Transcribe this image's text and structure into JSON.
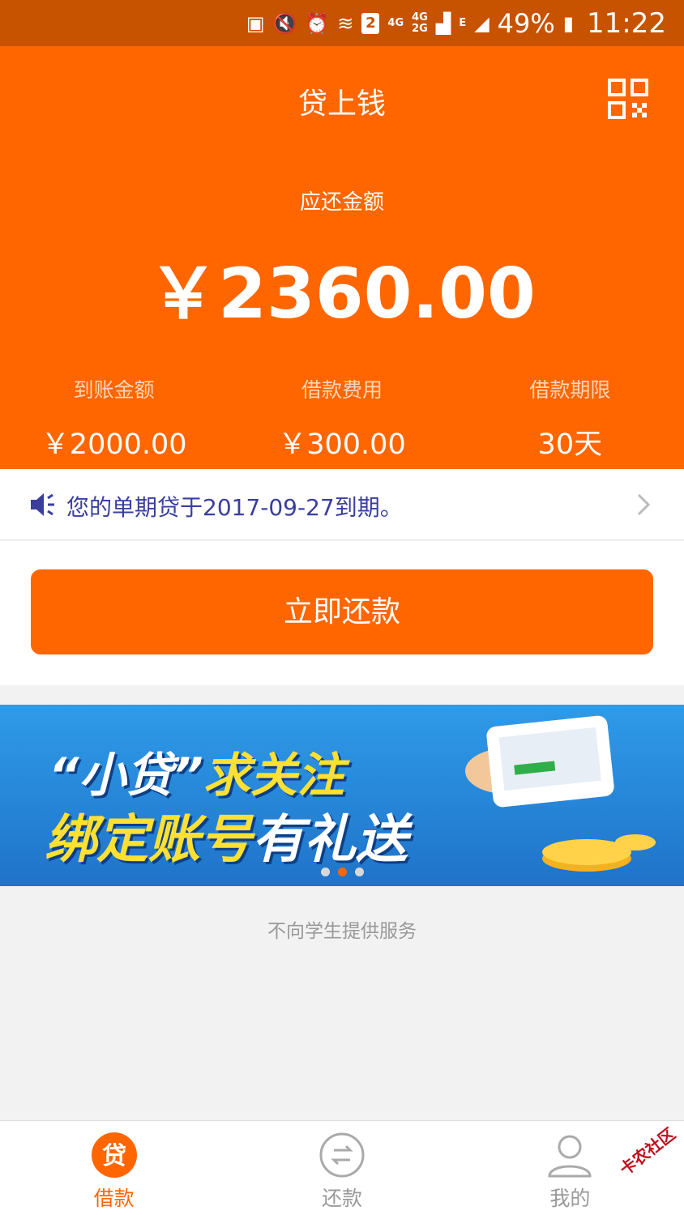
{
  "status_bar": {
    "sim_slot": "2",
    "network_1": "4G",
    "network_2a": "4G",
    "network_2b": "2G",
    "network_3": "E",
    "battery": "49%",
    "time": "11:22"
  },
  "header": {
    "title": "贷上钱",
    "due_label": "应还金额",
    "due_amount": "￥2360.00",
    "stats": [
      {
        "label": "到账金额",
        "value": "￥2000.00"
      },
      {
        "label": "借款费用",
        "value": "￥300.00"
      },
      {
        "label": "借款期限",
        "value": "30天"
      }
    ]
  },
  "notice": {
    "text": "您的单期贷于2017-09-27到期。"
  },
  "actions": {
    "repay_label": "立即还款"
  },
  "banner": {
    "line1_a": "“小贷”",
    "line1_b": "求关注",
    "line2_a": "绑定账号",
    "line2_b": "有礼送",
    "active_dot_index": 1,
    "dot_count": 3
  },
  "disclaimer": "不向学生提供服务",
  "tabs": [
    {
      "label": "借款",
      "icon": "loan-icon",
      "active": true,
      "glyph": "贷"
    },
    {
      "label": "还款",
      "icon": "repay-icon",
      "active": false
    },
    {
      "label": "我的",
      "icon": "profile-icon",
      "active": false
    }
  ],
  "watermark": "卡农社区",
  "colors": {
    "brand": "#ff6600",
    "status_bar": "#c75200",
    "notice_text": "#3a3f9e"
  }
}
